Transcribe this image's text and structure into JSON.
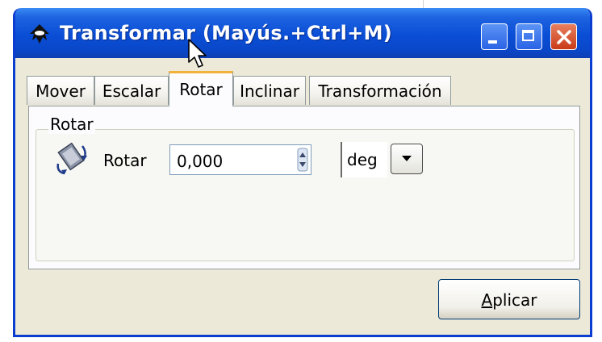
{
  "window": {
    "title": "Transformar (Mayús.+Ctrl+M)",
    "controls": {
      "minimize": "minimize",
      "maximize": "maximize",
      "close": "close"
    }
  },
  "tabs": [
    {
      "label": "Mover",
      "active": false
    },
    {
      "label": "Escalar",
      "active": false
    },
    {
      "label": "Rotar",
      "active": true
    },
    {
      "label": "Inclinar",
      "active": false
    },
    {
      "label": "Transformación",
      "active": false
    }
  ],
  "rotate_panel": {
    "group_label": "Rotar",
    "field_label": "Rotar",
    "value": "0,000",
    "unit": "deg"
  },
  "apply_button": {
    "mnemonic": "A",
    "rest": "plicar"
  },
  "icons": {
    "app": "inkscape-icon",
    "rotate": "rotate-icon",
    "cursor": "mouse-pointer-icon"
  },
  "colors": {
    "titlebar": "#0a4ed6",
    "close_button": "#c93b17",
    "active_tab_accent": "#f3b23c",
    "window_bg": "#ece9d8"
  }
}
